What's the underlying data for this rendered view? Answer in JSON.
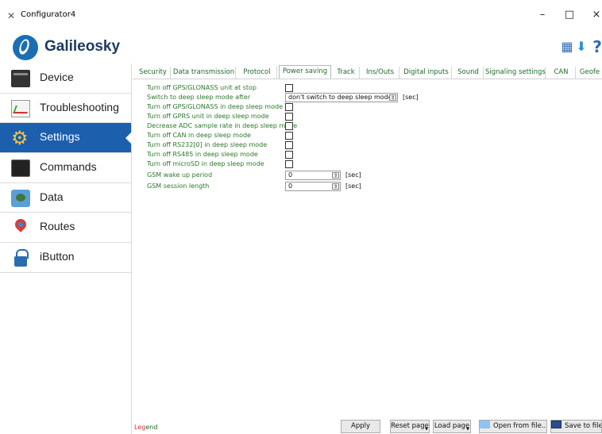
{
  "window": {
    "title": "Configurator4",
    "controls": {
      "minimize": "–",
      "maximize": "□",
      "close": "×"
    }
  },
  "brand": {
    "name": "Galileosky",
    "header_icons": [
      "translate-icon",
      "download-icon",
      "help-icon"
    ],
    "help_glyph": "?"
  },
  "colors": {
    "accent": "#1b5fad",
    "label_green": "#2a7a2a",
    "logo_blue": "#1a6fb3"
  },
  "sidebar": {
    "items": [
      {
        "label": "Device",
        "icon": "device-icon",
        "active": false
      },
      {
        "label": "Troubleshooting",
        "icon": "troubleshooting-icon",
        "active": false
      },
      {
        "label": "Settings",
        "icon": "settings-gear-icon",
        "active": true
      },
      {
        "label": "Commands",
        "icon": "commands-terminal-icon",
        "active": false
      },
      {
        "label": "Data",
        "icon": "data-icon",
        "active": false
      },
      {
        "label": "Routes",
        "icon": "routes-pin-icon",
        "active": false
      },
      {
        "label": "iButton",
        "icon": "ibutton-lock-icon",
        "active": false
      }
    ]
  },
  "tabs": [
    {
      "label": "Security",
      "active": false
    },
    {
      "label": "Data transmission",
      "active": false
    },
    {
      "label": "Protocol",
      "active": false
    },
    {
      "label": "Power saving",
      "active": true
    },
    {
      "label": "Track",
      "active": false
    },
    {
      "label": "Ins/Outs",
      "active": false
    },
    {
      "label": "Digital inputs",
      "active": false
    },
    {
      "label": "Sound",
      "active": false
    },
    {
      "label": "Signaling settings",
      "active": false
    },
    {
      "label": "CAN",
      "active": false
    },
    {
      "label": "Geofe",
      "active": false
    }
  ],
  "form": {
    "rows": [
      {
        "label": "Turn off GPS/GLONASS unit at stop",
        "control": "checkbox",
        "checked": false
      },
      {
        "label": "Switch to deep sleep mode after",
        "control": "combo",
        "value": "don't switch to deep sleep mode",
        "unit": "[sec]"
      },
      {
        "label": "Turn off GPS/GLONASS in deep sleep mode",
        "control": "checkbox",
        "checked": false
      },
      {
        "label": "Turn off GPRS unit in deep sleep mode",
        "control": "checkbox",
        "checked": false
      },
      {
        "label": "Decrease ADC sample rate in deep sleep mode",
        "control": "checkbox",
        "checked": false
      },
      {
        "label": "Turn off CAN in deep sleep mode",
        "control": "checkbox",
        "checked": false
      },
      {
        "label": "Turn off RS232[0] in deep sleep mode",
        "control": "checkbox",
        "checked": false
      },
      {
        "label": "Turn off RS485 in deep sleep mode",
        "control": "checkbox",
        "checked": false
      },
      {
        "label": "Turn off microSD in deep sleep mode",
        "control": "checkbox",
        "checked": false
      },
      {
        "label": "GSM wake up period",
        "control": "spin",
        "value": "0",
        "unit": "[sec]"
      },
      {
        "label": "GSM session length",
        "control": "spin",
        "value": "0",
        "unit": "[sec]"
      }
    ]
  },
  "bottom": {
    "legend_prefix": "Leg",
    "legend_suffix": "end",
    "apply": "Apply",
    "reset_page": "Reset page",
    "load_page": "Load page",
    "open_from_file": "Open from file...",
    "save_to_file": "Save to file..."
  }
}
